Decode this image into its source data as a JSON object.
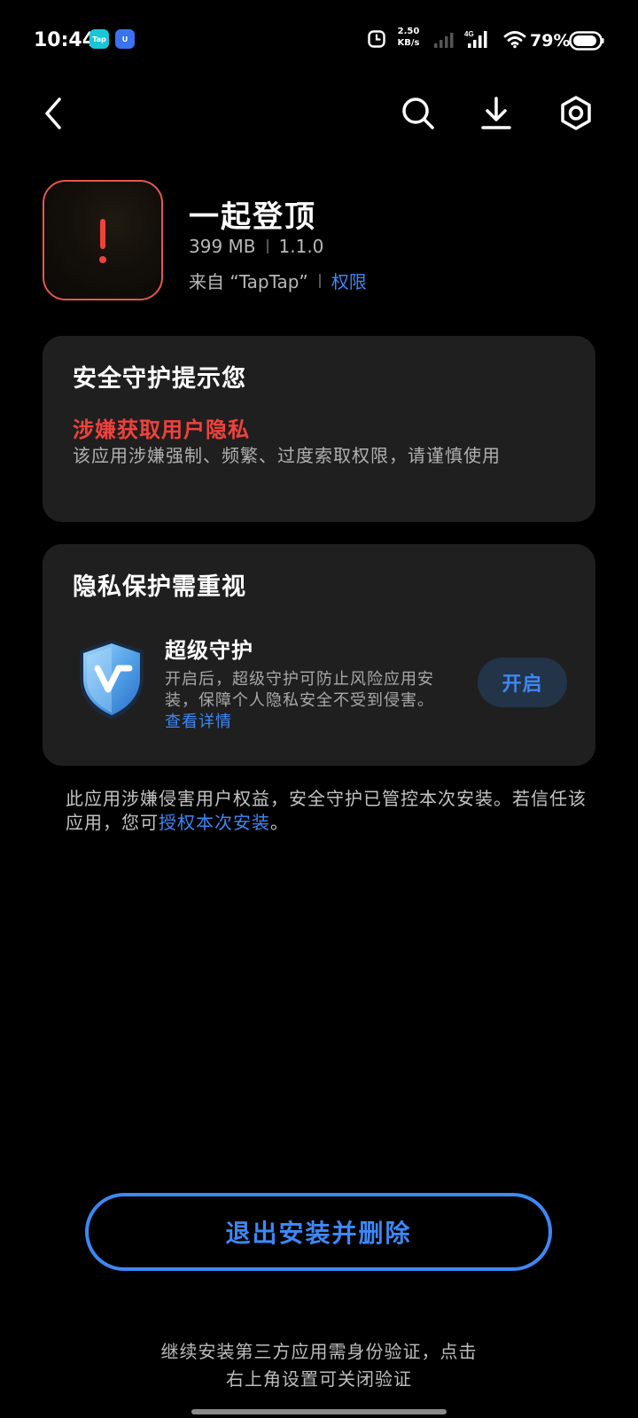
{
  "status_bar": {
    "time": "10:44",
    "app_icon_1": "Tap",
    "app_icon_2": "U",
    "net_speed_value": "2.50",
    "net_speed_unit": "KB/s",
    "network_type": "4G",
    "battery": "79%"
  },
  "top_bar": {
    "icons": [
      "back-icon",
      "search-icon",
      "download-icon",
      "settings-icon"
    ]
  },
  "app": {
    "name": "一起登顶",
    "size": "399 MB",
    "version": "1.1.0",
    "source": "来自 “TapTap”",
    "permissions_link": "权限"
  },
  "security_card": {
    "title": "安全守护提示您",
    "risk_title": "涉嫌获取用户隐私",
    "risk_desc": "该应用涉嫌强制、频繁、过度索取权限，请谨慎使用"
  },
  "privacy_card": {
    "title": "隐私保护需重视",
    "feature_title": "超级守护",
    "feature_desc": "开启后，超级守护可防止风险应用安装，保障个人隐私安全不受到侵害。",
    "details_link": "查看详情",
    "enable_button": "开启"
  },
  "notice": {
    "text_1": "此应用涉嫌侵害用户权益，安全守护已管控本次安装。若信任该应用，您可",
    "link": "授权本次安装",
    "text_2": "。"
  },
  "exit_button": "退出安装并删除",
  "footer": {
    "line_1": "继续安装第三方应用需身份验证，点击",
    "line_2": "右上角设置可关闭验证"
  },
  "colors": {
    "accent": "#3e87f5",
    "danger": "#f0423c",
    "card_bg": "#1f1f1f",
    "background": "#000000"
  }
}
